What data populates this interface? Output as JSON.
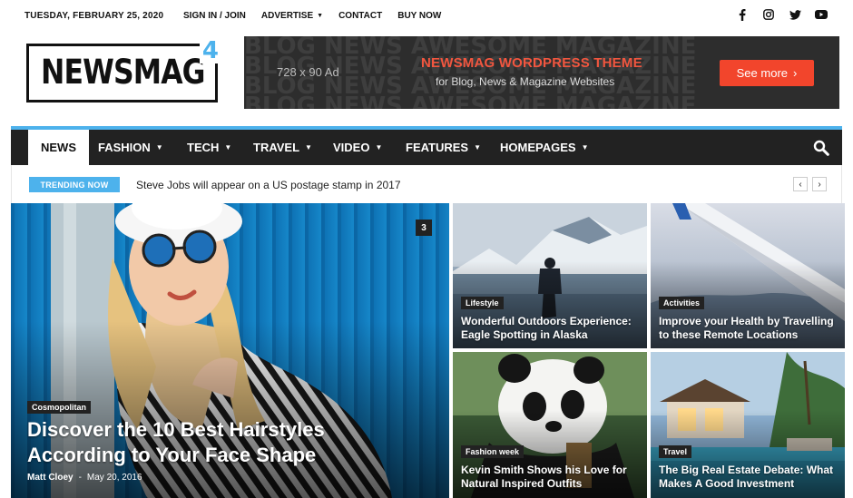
{
  "topbar": {
    "date": "TUESDAY, FEBRUARY 25, 2020",
    "menu": [
      {
        "label": "SIGN IN / JOIN"
      },
      {
        "label": "ADVERTISE"
      },
      {
        "label": "CONTACT"
      },
      {
        "label": "BUY NOW"
      }
    ],
    "social_icons": [
      "facebook-icon",
      "instagram-icon",
      "twitter-icon",
      "youtube-icon"
    ]
  },
  "logo": {
    "word": "NEWSMAG",
    "number": "4"
  },
  "ad": {
    "size": "728 x 90 Ad",
    "title": "NEWSMAG WORDPRESS THEME",
    "subtitle": "for Blog, News & Magazine Websites",
    "cta": "See more",
    "texture": "BLOG NEWS AWESOME MAGAZINE"
  },
  "nav": {
    "items": [
      {
        "label": "NEWS"
      },
      {
        "label": "FASHION"
      },
      {
        "label": "TECH"
      },
      {
        "label": "TRAVEL"
      },
      {
        "label": "VIDEO"
      },
      {
        "label": "FEATURES"
      },
      {
        "label": "HOMEPAGES"
      }
    ]
  },
  "trending": {
    "badge": "TRENDING NOW",
    "headline": "Steve Jobs will appear on a US postage stamp in 2017"
  },
  "featured": {
    "category": "Cosmopolitan",
    "title": "Discover the 10 Best Hairstyles According to Your Face Shape",
    "author": "Matt Cloey",
    "separator": "-",
    "date": "May 20, 2016",
    "comments": "3"
  },
  "cards": [
    {
      "category": "Lifestyle",
      "title": "Wonderful Outdoors Experience: Eagle Spotting in Alaska"
    },
    {
      "category": "Activities",
      "title": "Improve your Health by Travelling to these Remote Locations"
    },
    {
      "category": "Fashion week",
      "title": "Kevin Smith Shows his Love for Natural Inspired Outfits"
    },
    {
      "category": "Travel",
      "title": "The Big Real Estate Debate: What Makes A Good Investment"
    }
  ],
  "colors": {
    "accent": "#4db2ec",
    "ad_red": "#f2452c",
    "nav_bg": "#222222"
  }
}
